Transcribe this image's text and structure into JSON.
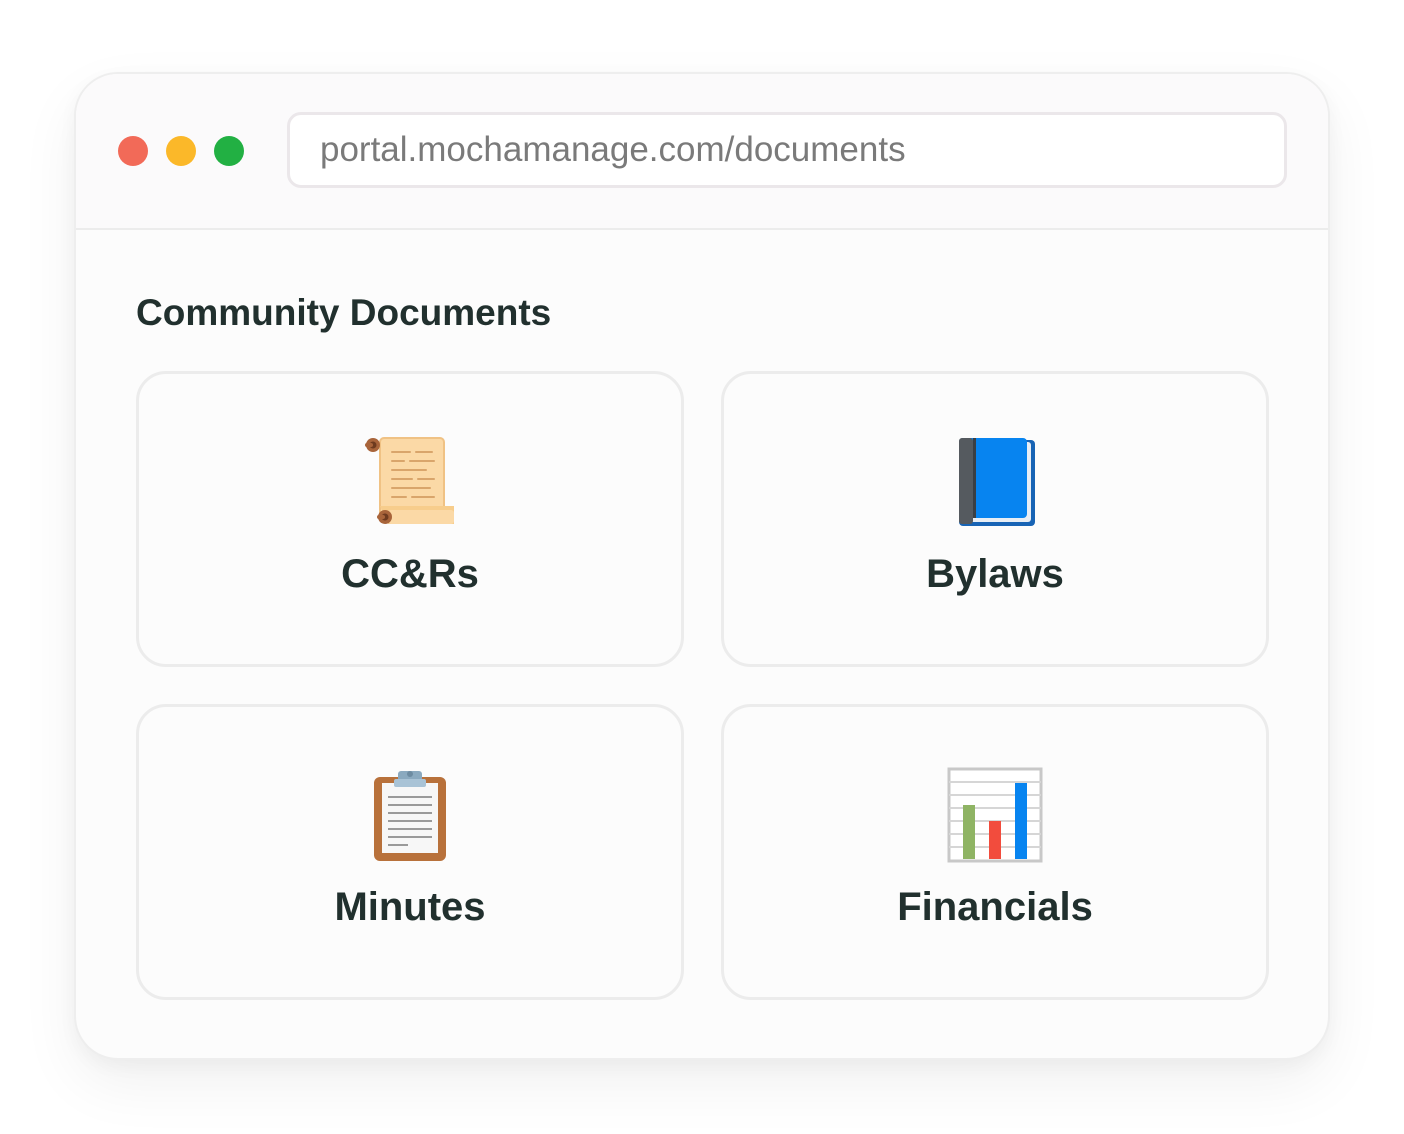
{
  "browser": {
    "url": "portal.mochamanage.com/documents",
    "controls": {
      "close_color": "#f26a58",
      "minimize_color": "#fbb829",
      "maximize_color": "#22b043"
    }
  },
  "page": {
    "heading": "Community Documents"
  },
  "documents": [
    {
      "label": "CC&Rs",
      "icon": "scroll-icon"
    },
    {
      "label": "Bylaws",
      "icon": "blue-book-icon"
    },
    {
      "label": "Minutes",
      "icon": "clipboard-icon"
    },
    {
      "label": "Financials",
      "icon": "bar-chart-icon"
    }
  ]
}
